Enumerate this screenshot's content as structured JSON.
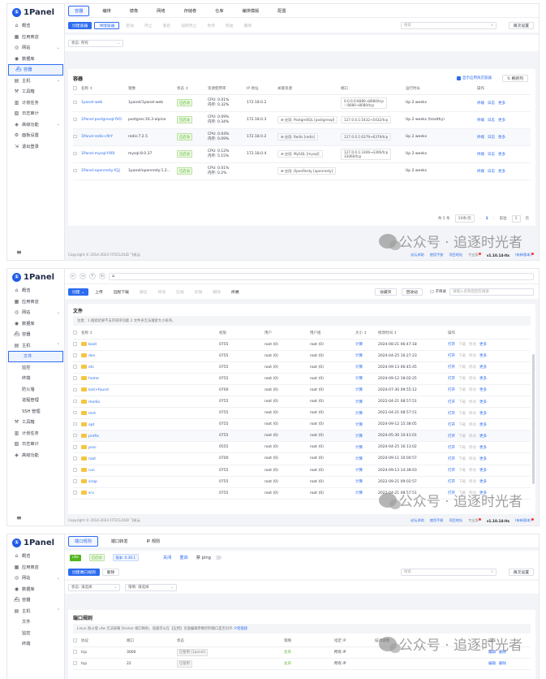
{
  "brand": {
    "name": "1Panel"
  },
  "footer": {
    "copyright": "Copyright © 2014-2024 FIT2CLOUD 飞致云",
    "forum": "论坛求助",
    "docs": "使用手册",
    "project": "项目地址",
    "edition": "专业版",
    "version": "v1.10.14-lts",
    "new_version": "(有新版本)"
  },
  "watermark": "公众号 · 追逐时光者",
  "screen1": {
    "nav": [
      {
        "icon": "⌂",
        "label": "概览"
      },
      {
        "icon": "▦",
        "label": "应用商店"
      },
      {
        "icon": "◎",
        "label": "网站",
        "chev": "⌄"
      },
      {
        "icon": "◉",
        "label": "数据库"
      },
      {
        "icon": "⛴",
        "label": "容器"
      },
      {
        "icon": "▤",
        "label": "主机",
        "chev": "⌄"
      },
      {
        "icon": "⚒",
        "label": "工具箱"
      },
      {
        "icon": "▥",
        "label": "计划任务"
      },
      {
        "icon": "▧",
        "label": "日志审计"
      },
      {
        "icon": "◈",
        "label": "高级功能",
        "chev": "⌄"
      },
      {
        "icon": "⚙",
        "label": "面板设置"
      },
      {
        "icon": "⇲",
        "label": "退出登录"
      }
    ],
    "tabs": [
      "容器",
      "编排",
      "镜像",
      "网络",
      "存储卷",
      "仓库",
      "编排模版",
      "配置"
    ],
    "toolbar": {
      "create": "创建容器",
      "clean": "清理容器",
      "actions": [
        "启动",
        "停止",
        "重启",
        "强制停止",
        "暂停",
        "恢复",
        "删除"
      ]
    },
    "search_placeholder": "搜索",
    "reset": "再次设置",
    "filter": {
      "label": "状态: 所有",
      "arrow": "⌄"
    },
    "card_title": "容器",
    "show_app": "显示应用商店容器",
    "refresh": "↻ 刷新列",
    "columns": [
      "名称 ↕",
      "镜像",
      "状态 ↕",
      "资源使用率",
      "IP 地址",
      "关联资源",
      "端口",
      "运行时长",
      "操作"
    ],
    "rows": [
      {
        "name": "1panel-web",
        "image": "1panel/1panel-web",
        "status": "已启动",
        "cpu": "CPU: 0.01%",
        "mem": "内存: 0.32%",
        "ip": "172.18.0.2",
        "res": "",
        "port1": "0.0.0.0:8080→8080/tcp",
        "port2": ":::8080→8080/tcp",
        "uptime": "Up 2 weeks"
      },
      {
        "name": "1Panel-postgresql-fVO",
        "image": "postgres:16.3-alpine",
        "status": "已启动",
        "cpu": "CPU: 0.09%",
        "mem": "内存: 0.34%",
        "ip": "172.18.0.3",
        "res": "⊕ 应用: PostgreSQL [postgresql]",
        "port1": "127.0.0.1:5432→5432/tcp",
        "port2": "",
        "uptime": "Up 2 weeks (healthy)"
      },
      {
        "name": "1Panel-redis-c9rY",
        "image": "redis:7.2.5",
        "status": "已启动",
        "cpu": "CPU: 0.04%",
        "mem": "内存: 0.09%",
        "ip": "172.18.0.2",
        "res": "⊕ 应用: Redis [redis]",
        "port1": "127.0.0.1:6379→6379/tcp",
        "port2": "",
        "uptime": "Up 2 weeks"
      },
      {
        "name": "1Panel-mysql-YXRI",
        "image": "mysql:8.0.37",
        "status": "已启动",
        "cpu": "CPU: 0.12%",
        "mem": "内存: 5.15%",
        "ip": "172.18.0.4",
        "res": "⊕ 应用: MySQL [mysql]",
        "port1": "127.0.0.1:3306→3306/tcp",
        "port2": "33060/tcp",
        "uptime": "Up 2 weeks"
      },
      {
        "name": "1Panel-openresty-lCJJ",
        "image": "1panel/openresty:1.2...",
        "status": "已启动",
        "cpu": "CPU: 0.01%",
        "mem": "内存: 0.2%",
        "ip": "",
        "res": "⊕ 应用: OpenResty [openresty]",
        "port1": "",
        "port2": "",
        "uptime": "Up 2 weeks"
      }
    ],
    "row_actions": [
      "终端",
      "日志",
      "更多"
    ],
    "pager": {
      "total": "共 5 条",
      "size": "10条/页",
      "prev": "‹",
      "page": "1",
      "next": "›",
      "goto": "前往",
      "goto_val": "1",
      "suffix": "页"
    }
  },
  "screen2": {
    "nav": [
      {
        "icon": "⌂",
        "label": "概览"
      },
      {
        "icon": "▦",
        "label": "应用商店"
      },
      {
        "icon": "◎",
        "label": "网站",
        "chev": "⌄"
      },
      {
        "icon": "◉",
        "label": "数据库"
      },
      {
        "icon": "⛴",
        "label": "容器"
      },
      {
        "icon": "▤",
        "label": "主机",
        "chev": "⌃"
      }
    ],
    "subnav": [
      "文件",
      "监控",
      "终端",
      "防火墙",
      "进程管理",
      "SSH 管理"
    ],
    "nav_after": [
      {
        "icon": "⚒",
        "label": "工具箱"
      },
      {
        "icon": "▥",
        "label": "计划任务"
      },
      {
        "icon": "▧",
        "label": "日志审计"
      },
      {
        "icon": "◈",
        "label": "高级功能"
      }
    ],
    "addr": {
      "back": "←",
      "forward": "→",
      "up": "↑",
      "refresh": "↻",
      "home": "⌂"
    },
    "toolbar": {
      "create": "创建 ⌄",
      "upload": "上传",
      "remote": "远程下载",
      "actions": [
        "解压",
        "移动",
        "压缩",
        "权限",
        "删除"
      ],
      "terminal": "终端"
    },
    "right_buttons": [
      "收藏夹",
      "回收站"
    ],
    "sub_dir": "子目录",
    "search_placeholder": "请输入名称后回车搜索",
    "card_title": "文件",
    "note": "注意：1.搜索结果不支持排序功能 2.文件夹无法搜索大小排序。",
    "columns": [
      "名称 ↕",
      "权限",
      "用户",
      "用户组",
      "大小 ↕",
      "修改时间 ↕",
      "操作"
    ],
    "rows": [
      {
        "name": "boot",
        "perm": "0755",
        "user": "root (0)",
        "group": "root (0)",
        "size": "计算",
        "time": "2024-08-21 06:47:18"
      },
      {
        "name": "dev",
        "perm": "0755",
        "user": "root (0)",
        "group": "root (0)",
        "size": "计算",
        "time": "2024-04-25 16:27:23"
      },
      {
        "name": "etc",
        "perm": "0755",
        "user": "root (0)",
        "group": "root (0)",
        "size": "计算",
        "time": "2024-09-13 06:45:45"
      },
      {
        "name": "home",
        "perm": "0755",
        "user": "root (0)",
        "group": "root (0)",
        "size": "计算",
        "time": "2024-09-12 18:02:25"
      },
      {
        "name": "lost+found",
        "perm": "0700",
        "user": "root (0)",
        "group": "root (0)",
        "size": "计算",
        "time": "2024-07-30 09:55:12"
      },
      {
        "name": "media",
        "perm": "0755",
        "user": "root (0)",
        "group": "root (0)",
        "size": "计算",
        "time": "2022-04-21 08:57:51"
      },
      {
        "name": "mnt",
        "perm": "0755",
        "user": "root (0)",
        "group": "root (0)",
        "size": "计算",
        "time": "2022-04-21 08:57:51"
      },
      {
        "name": "opt",
        "perm": "0755",
        "user": "root (0)",
        "group": "root (0)",
        "size": "计算",
        "time": "2024-09-12 15:38:05"
      },
      {
        "name": "prefix",
        "perm": "0755",
        "user": "root (0)",
        "group": "root (0)",
        "size": "计算",
        "time": "2024-05-30 10:41:01"
      },
      {
        "name": "proc",
        "perm": "0555",
        "user": "root (0)",
        "group": "root (0)",
        "size": "计算",
        "time": "2024-04-25 16:13:02"
      },
      {
        "name": "root",
        "perm": "0700",
        "user": "root (0)",
        "group": "root (0)",
        "size": "计算",
        "time": "2024-09-11 10:00:57"
      },
      {
        "name": "run",
        "perm": "0755",
        "user": "root (0)",
        "group": "root (0)",
        "size": "计算",
        "time": "2024-09-13 14:38:03"
      },
      {
        "name": "snap",
        "perm": "0755",
        "user": "root (0)",
        "group": "root (0)",
        "size": "计算",
        "time": "2022-09-21 09:02:57"
      },
      {
        "name": "srv",
        "perm": "0755",
        "user": "root (0)",
        "group": "root (0)",
        "size": "计算",
        "time": "2022-04-21 08:57:51"
      }
    ],
    "row_actions": [
      "打开",
      "下载",
      "移动",
      "更多"
    ]
  },
  "screen3": {
    "nav": [
      {
        "icon": "⌂",
        "label": "概览"
      },
      {
        "icon": "▦",
        "label": "应用商店"
      },
      {
        "icon": "◎",
        "label": "网站",
        "chev": "⌄"
      },
      {
        "icon": "◉",
        "label": "数据库"
      },
      {
        "icon": "⛴",
        "label": "容器"
      },
      {
        "icon": "▤",
        "label": "主机",
        "chev": "⌃"
      }
    ],
    "subnav": [
      "文件",
      "监控",
      "终端"
    ],
    "tabs": [
      "端口规则",
      "端口转发",
      "IP 规则"
    ],
    "status": {
      "engine": "ufw",
      "running": "已启动",
      "version": "版本: 0.36.1",
      "stop": "关闭",
      "restart": "重启",
      "ping": "禁 ping"
    },
    "toolbar": {
      "create": "创建端口规则",
      "delete": "删除"
    },
    "search_placeholder": "搜索",
    "reset": "再次设置",
    "filters": [
      {
        "label": "状态: 请选择",
        "arrow": "⌄"
      },
      {
        "label": "策略: 请选择",
        "arrow": "⌄"
      }
    ],
    "card_title": "端口规则",
    "note": "Linux 防火墙 ufw 无法屏蔽 Docker 端口映射，容器可以在【应用】页面编辑参数控制端口是否对外",
    "note_link": "介绍链接",
    "columns": [
      "协议",
      "端口",
      "状态",
      "策略",
      "指定 IP",
      "描述说明",
      "操作"
    ],
    "rows": [
      {
        "proto": "tcp",
        "port": "3000",
        "status": "已使用 (1panel)",
        "policy": "允许",
        "ip": "所有 IP",
        "desc": ""
      },
      {
        "proto": "tcp",
        "port": "22",
        "status": "已使用",
        "policy": "允许",
        "ip": "所有 IP",
        "desc": ""
      }
    ],
    "row_actions": [
      "编辑",
      "删除"
    ]
  }
}
